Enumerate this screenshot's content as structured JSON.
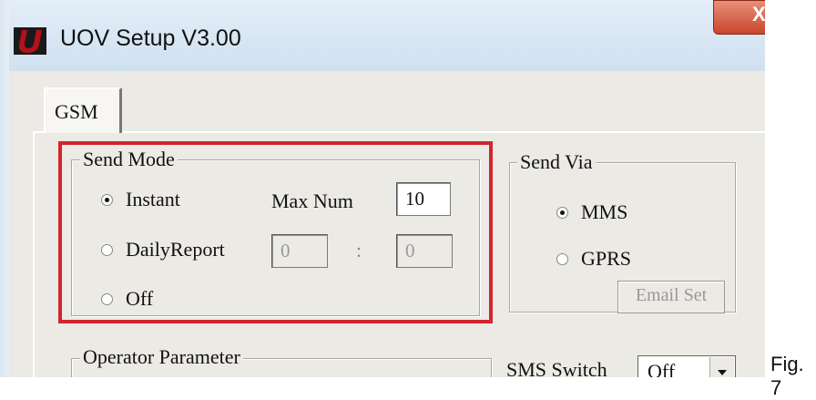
{
  "window": {
    "title": "UOV Setup V3.00",
    "close_label": "X",
    "accent_color": "#b3121a"
  },
  "tabs": [
    {
      "label": "GSM",
      "selected": true
    }
  ],
  "send_mode": {
    "title": "Send Mode",
    "instant_label": "Instant",
    "max_num_label": "Max Num",
    "max_num_value": "10",
    "daily_label": "DailyReport",
    "daily_hour": "0",
    "separator": ":",
    "daily_minute": "0",
    "off_label": "Off",
    "selected": "Instant",
    "highlight_color": "#d0262e"
  },
  "send_via": {
    "title": "Send Via",
    "mms_label": "MMS",
    "gprs_label": "GPRS",
    "selected": "MMS",
    "email_set_label": "Email Set"
  },
  "operator": {
    "title": "Operator Parameter"
  },
  "sms_switch": {
    "label": "SMS Switch",
    "value": "Off"
  },
  "caption": "Fig. 7"
}
